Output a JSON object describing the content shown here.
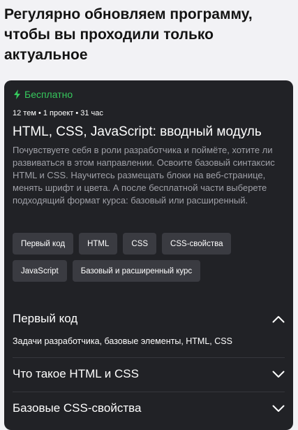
{
  "heading": "Регулярно обновляем программу, чтобы вы проходили только актуальное",
  "card": {
    "badge": {
      "icon": "lightning-icon",
      "label": "Бесплатно",
      "color": "#36c95d"
    },
    "meta": "12 тем • 1 проект • 31 час",
    "title": "HTML, CSS, JavaScript: вводный модуль",
    "description": "Почувствуете себя в роли разработчика и поймёте, хотите ли развиваться в этом направлении. Освоите базовый синтаксис HTML и CSS. Научитесь размещать блоки на веб-странице, менять шрифт и цвета. А после бесплатной части выберете подходящий формат курса: базовый или расширенный.",
    "tags": [
      "Первый код",
      "HTML",
      "CSS",
      "CSS-свойства",
      "JavaScript",
      "Базовый и расширенный курс"
    ],
    "accordion": [
      {
        "title": "Первый код",
        "expanded": true,
        "icon": "chevron-up-icon",
        "content": "Задачи разработчика, базовые элементы, HTML, CSS"
      },
      {
        "title": "Что такое HTML и CSS",
        "expanded": false,
        "icon": "chevron-down-icon"
      },
      {
        "title": "Базовые CSS-свойства",
        "expanded": false,
        "icon": "chevron-down-icon"
      }
    ]
  }
}
